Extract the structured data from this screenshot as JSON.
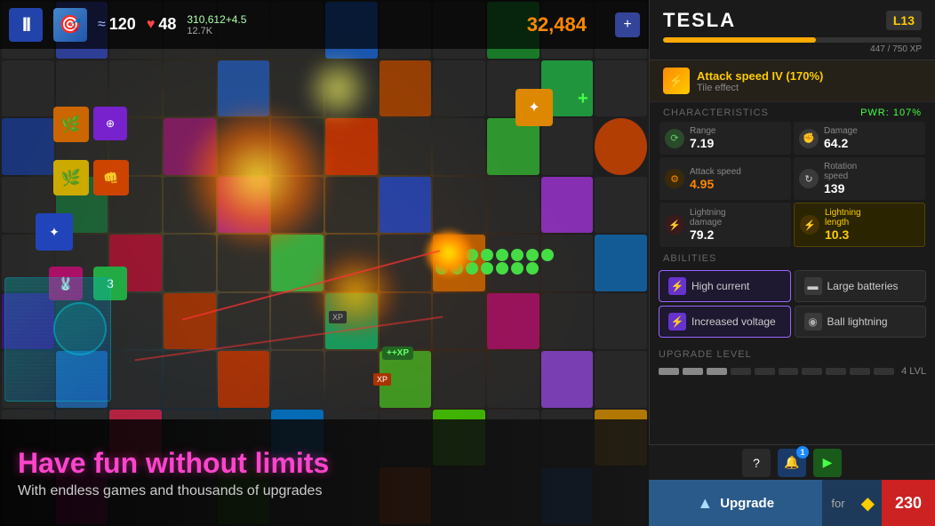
{
  "game": {
    "pause_label": "II",
    "hud": {
      "wave_icon": "≈",
      "wave_count": "120",
      "heart_icon": "♥",
      "lives": "48",
      "dps_label": "310,612+4.5",
      "mdps_label": "12.7K",
      "score": "32,484"
    },
    "banner": {
      "title": "Have fun without limits",
      "subtitle": "With endless games and thousands of upgrades"
    }
  },
  "panel": {
    "tower_name": "TESLA",
    "level_label": "L13",
    "xp_current": 447,
    "xp_max": 750,
    "xp_label": "447 / 750 XP",
    "xp_percent": 59,
    "tile_effect": {
      "name": "Attack speed IV (170%)",
      "sub": "Tile effect"
    },
    "characteristics_label": "CHARACTERISTICS",
    "pwr_label": "PWR: 107%",
    "stats": [
      {
        "icon": "⟳",
        "label": "Range",
        "value": "7.19",
        "highlighted": false,
        "icon_color": "#448844"
      },
      {
        "icon": "✊",
        "label": "Damage",
        "value": "64.2",
        "highlighted": false,
        "icon_color": "#888"
      },
      {
        "icon": "⚡",
        "label": "Attack speed",
        "value": "4.95",
        "highlighted": false,
        "icon_color": "#ff8800"
      },
      {
        "icon": "↻",
        "label": "Rotation speed",
        "value": "139",
        "highlighted": false,
        "icon_color": "#888"
      },
      {
        "icon": "⚡",
        "label": "Lightning damage",
        "value": "79.2",
        "highlighted": false,
        "icon_color": "#ff4444"
      },
      {
        "icon": "⚡",
        "label": "Lightning length",
        "value": "10.3",
        "highlighted": true,
        "icon_color": "#ffcc00"
      }
    ],
    "abilities_label": "ABILITIES",
    "abilities": [
      {
        "name": "High current",
        "icon": "⚡",
        "active": true
      },
      {
        "name": "Large batteries",
        "icon": "🔋",
        "active": false
      },
      {
        "name": "Increased voltage",
        "icon": "⚡",
        "active": true
      },
      {
        "name": "Ball lightning",
        "icon": "●",
        "active": false
      }
    ],
    "upgrade_level_label": "UPGRADE LEVEL",
    "upgrade_lvl_number": "4 LVL",
    "upgrade_segments_filled": 3,
    "upgrade_segments_total": 10,
    "upgrade_button_label": "Upgrade",
    "upgrade_for_label": "for",
    "upgrade_cost": "230",
    "bottom_icons": [
      "?",
      "1",
      "▶",
      "✦"
    ]
  }
}
